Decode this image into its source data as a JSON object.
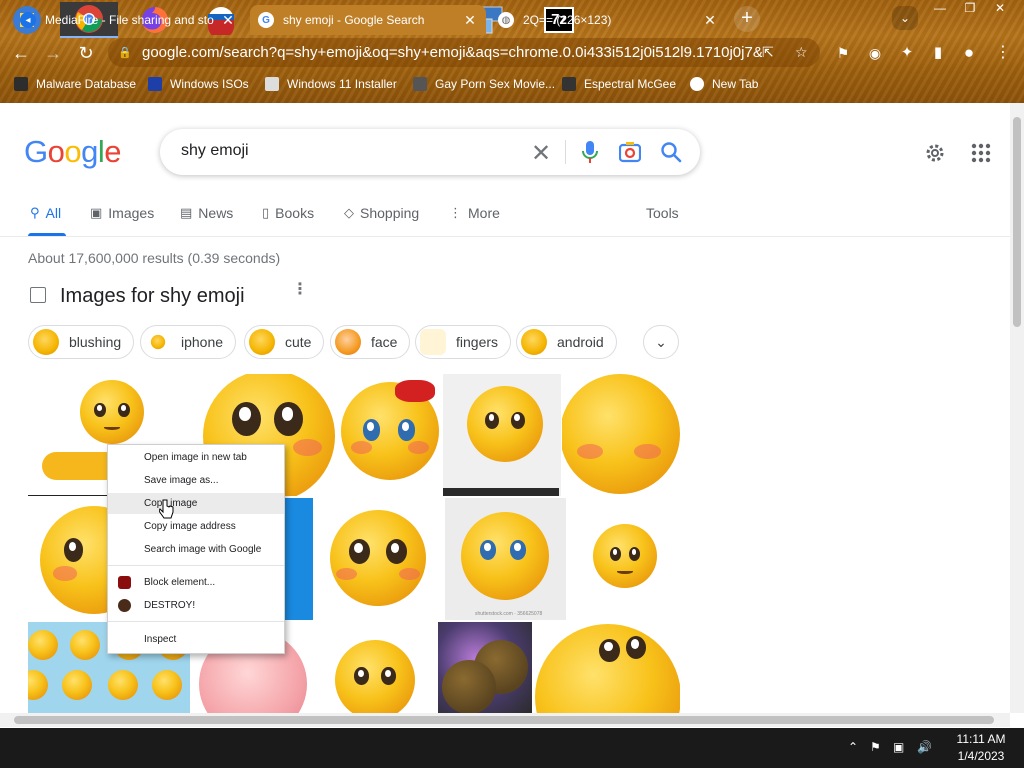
{
  "browser": {
    "tabs": [
      {
        "title": "MediaFire - File sharing and stora",
        "active": false
      },
      {
        "title": "shy emoji - Google Search",
        "active": true
      },
      {
        "title": "2Q== (226×123)",
        "active": false
      }
    ],
    "url": "google.com/search?q=shy+emoji&oq=shy+emoji&aqs=chrome.0.0i433i512j0i512l9.1710j0j7&...",
    "bookmarks": [
      "Malware Database",
      "Windows ISOs",
      "Windows 11 Installer",
      "Gay Porn Sex Movie...",
      "Espectral McGee",
      "New Tab"
    ]
  },
  "google": {
    "logo": "Google",
    "query": "shy emoji",
    "nav": [
      "All",
      "Images",
      "News",
      "Books",
      "Shopping",
      "More"
    ],
    "tools": "Tools",
    "stats": "About 17,600,000 results (0.39 seconds)",
    "section_title": "Images for shy emoji",
    "chips": [
      "blushing",
      "iphone",
      "cute",
      "face",
      "fingers",
      "android"
    ],
    "watermark": "shutterstock.com · 356625078"
  },
  "context_menu": {
    "items": [
      "Open image in new tab",
      "Save image as...",
      "Copy image",
      "Copy image address",
      "Search image with Google",
      "Block element...",
      "DESTROY!",
      "Inspect"
    ],
    "highlighted": "Copy image"
  },
  "taskbar": {
    "clock_time": "11:11 AM",
    "clock_date": "1/4/2023",
    "sevenzip": "7z"
  },
  "colors": {
    "google_blue": "#4285F4",
    "google_red": "#EA4335",
    "google_yellow": "#FBBC05",
    "google_green": "#34A853",
    "link_blue": "#1a73e8"
  }
}
